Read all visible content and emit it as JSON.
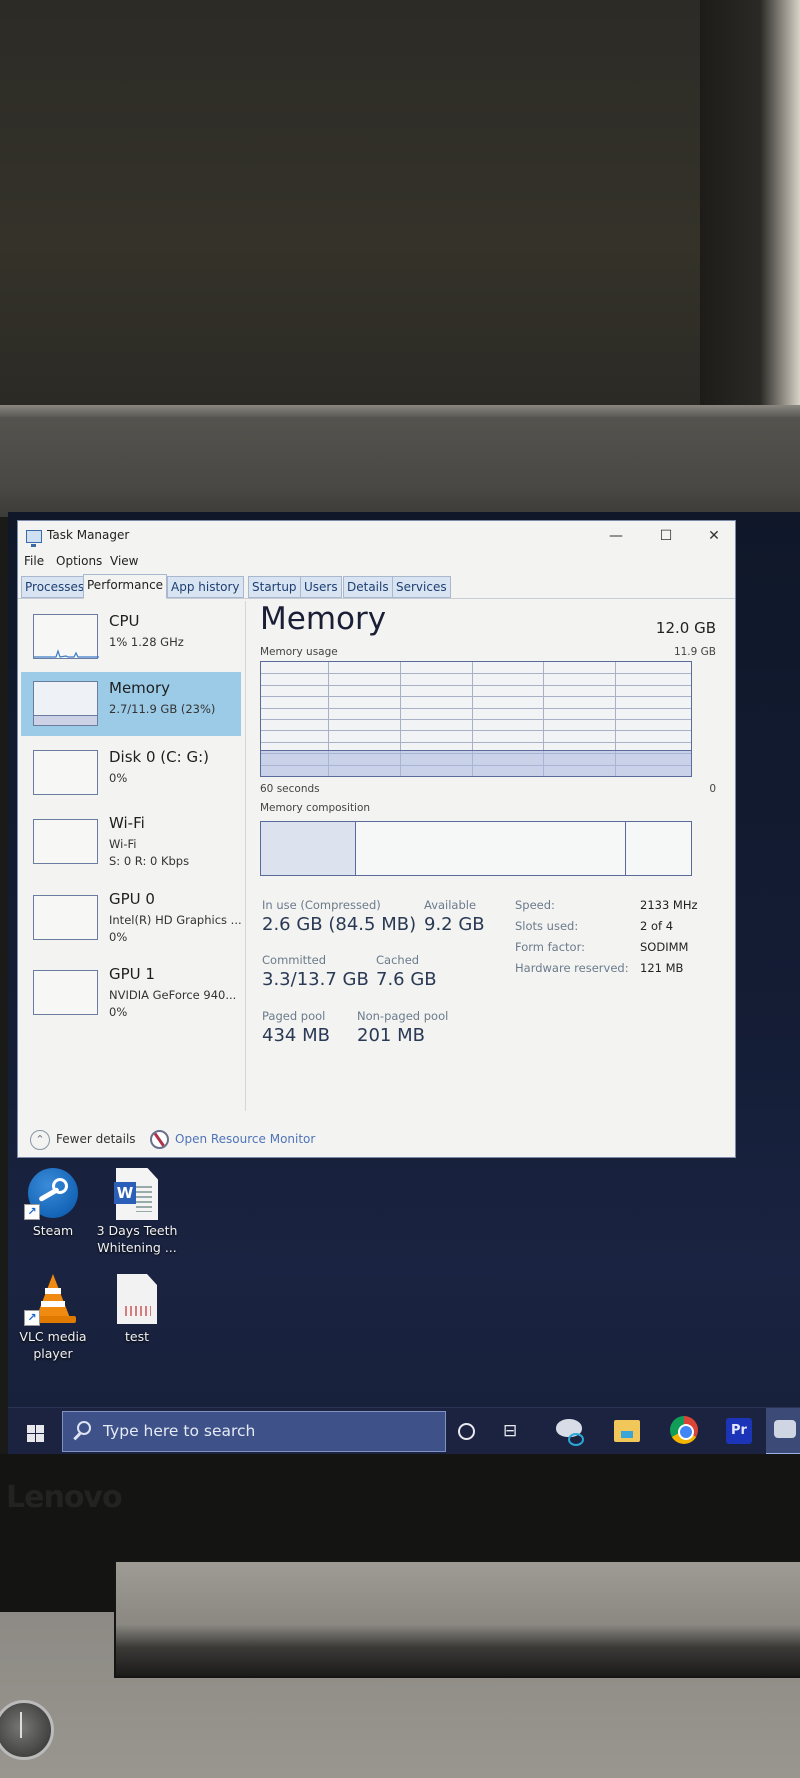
{
  "window": {
    "title": "Task Manager",
    "controls": {
      "minimize": "—",
      "maximize": "☐",
      "close": "✕"
    }
  },
  "menu": [
    "File",
    "Options",
    "View"
  ],
  "tabs": [
    {
      "label": "Processes",
      "active": false
    },
    {
      "label": "Performance",
      "active": true
    },
    {
      "label": "App history",
      "active": false
    },
    {
      "label": "Startup",
      "active": false
    },
    {
      "label": "Users",
      "active": false
    },
    {
      "label": "Details",
      "active": false
    },
    {
      "label": "Services",
      "active": false
    }
  ],
  "sidebar": {
    "items": [
      {
        "name": "CPU",
        "lines": [
          "1% 1.28 GHz"
        ],
        "selected": false
      },
      {
        "name": "Memory",
        "lines": [
          "2.7/11.9 GB (23%)"
        ],
        "selected": true
      },
      {
        "name": "Disk 0 (C: G:)",
        "lines": [
          "0%"
        ],
        "selected": false
      },
      {
        "name": "Wi-Fi",
        "lines": [
          "Wi-Fi",
          "S: 0 R: 0 Kbps"
        ],
        "selected": false
      },
      {
        "name": "GPU 0",
        "lines": [
          "Intel(R) HD Graphics ...",
          "0%"
        ],
        "selected": false
      },
      {
        "name": "GPU 1",
        "lines": [
          "NVIDIA GeForce 940...",
          "0%"
        ],
        "selected": false
      }
    ]
  },
  "main": {
    "title": "Memory",
    "total": "12.0 GB",
    "usage_graph": {
      "label": "Memory usage",
      "max_label": "11.9 GB",
      "time_left": "60 seconds",
      "time_right": "0",
      "used_fraction": 0.23
    },
    "composition": {
      "label": "Memory composition",
      "in_use_fraction": 0.22,
      "standby_fraction": 0.63,
      "free_fraction": 0.15
    },
    "stats": {
      "in_use_label": "In use (Compressed)",
      "in_use_value": "2.6 GB (84.5 MB)",
      "available_label": "Available",
      "available_value": "9.2 GB",
      "committed_label": "Committed",
      "committed_value": "3.3/13.7 GB",
      "cached_label": "Cached",
      "cached_value": "7.6 GB",
      "paged_pool_label": "Paged pool",
      "paged_pool_value": "434 MB",
      "nonpaged_pool_label": "Non-paged pool",
      "nonpaged_pool_value": "201 MB"
    },
    "specs": [
      {
        "label": "Speed:",
        "value": "2133 MHz"
      },
      {
        "label": "Slots used:",
        "value": "2 of 4"
      },
      {
        "label": "Form factor:",
        "value": "SODIMM"
      },
      {
        "label": "Hardware reserved:",
        "value": "121 MB"
      }
    ]
  },
  "footer": {
    "fewer_details": "Fewer details",
    "open_resource_monitor": "Open Resource Monitor"
  },
  "desktop_icons": [
    {
      "label": "Steam",
      "icon": "steam-icon"
    },
    {
      "label": "3 Days Teeth Whitening ...",
      "icon": "word-document-icon"
    },
    {
      "label": "VLC media player",
      "icon": "vlc-icon"
    },
    {
      "label": "test",
      "icon": "file-icon"
    }
  ],
  "taskbar": {
    "search_placeholder": "Type here to search",
    "pinned": [
      "cortana-icon",
      "task-view-icon",
      "paint-3d-icon",
      "file-explorer-icon",
      "chrome-icon",
      "premiere-pro-icon",
      "task-manager-icon"
    ],
    "premiere_label": "Pr"
  },
  "device": {
    "brand": "Lenovo"
  },
  "colors": {
    "selected_item": "#9ccbe8",
    "graph_border": "#5b6a9a",
    "link": "#4f74b8",
    "taskbar": "#1b2340",
    "search_box": "#3e5289"
  }
}
